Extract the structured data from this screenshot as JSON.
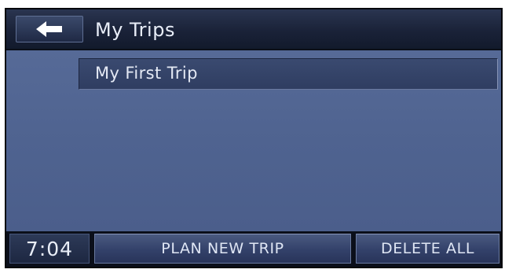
{
  "header": {
    "back_icon": "left-arrow-icon",
    "title": "My Trips"
  },
  "trips": {
    "items": [
      {
        "label": "My First Trip"
      }
    ]
  },
  "footer": {
    "clock": "7:04",
    "plan_label": "PLAN NEW TRIP",
    "delete_label": "DELETE ALL"
  },
  "colors": {
    "background_blue": "#4f6390",
    "header_dark": "#1a2238",
    "text": "#e8edf7"
  }
}
